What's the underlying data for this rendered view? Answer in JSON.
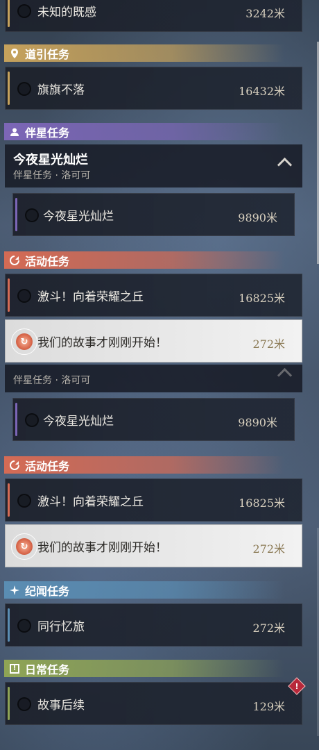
{
  "rows": {
    "r0": {
      "name": "未知的既感",
      "dist": "3242米"
    },
    "guide": {
      "name": "旗旗不落",
      "dist": "16432米"
    },
    "comp1": {
      "name": "今夜星光灿烂",
      "dist": "9890米"
    },
    "event1a": {
      "name": "激斗！向着荣耀之丘",
      "dist": "16825米"
    },
    "event1b": {
      "name": "我们的故事才刚刚开始！",
      "dist": "272米"
    },
    "comp2": {
      "name": "今夜星光灿烂",
      "dist": "9890米"
    },
    "event2a": {
      "name": "激斗！向着荣耀之丘",
      "dist": "16825米"
    },
    "event2b": {
      "name": "我们的故事才刚刚开始！",
      "dist": "272米"
    },
    "chron": {
      "name": "同行忆旅",
      "dist": "272米"
    },
    "daily": {
      "name": "故事后续",
      "dist": "129米"
    }
  },
  "headers": {
    "guide": "道引任务",
    "companion": "伴星任务",
    "event1": "活动任务",
    "event2": "活动任务",
    "chronicle": "纪闻任务",
    "daily": "日常任务"
  },
  "group": {
    "title": "今夜星光灿烂",
    "subtitle": "伴星任务 · 洛可可",
    "subtitle_repeat": "伴星任务 · 洛可可"
  },
  "icons": {
    "guide": "map-pin-icon",
    "companion": "person-icon",
    "event": "refresh-icon",
    "chronicle": "sparkle-icon",
    "daily": "exclamation-icon",
    "alert": "exclamation-icon"
  },
  "colors": {
    "guide": "#c6a25c",
    "companion": "#7c66b7",
    "event": "#d56b55",
    "chronicle": "#5a8db3",
    "daily": "#8fa455"
  }
}
